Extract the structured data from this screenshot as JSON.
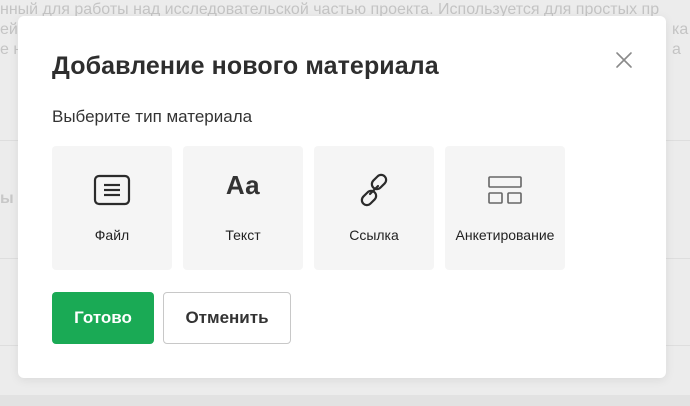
{
  "background": {
    "text_line": "нный для работы над исследовательской частью проекта. Используется для простых пр",
    "frag_right": "ка а",
    "frag_left": "ей",
    "frag_left2": "е н",
    "side_label": "ы"
  },
  "modal": {
    "title": "Добавление нового материала",
    "subtitle": "Выберите тип материала",
    "types": [
      {
        "label": "Файл",
        "icon": "file-icon"
      },
      {
        "label": "Текст",
        "icon": "text-icon",
        "glyph": "Aa"
      },
      {
        "label": "Ссылка",
        "icon": "link-icon"
      },
      {
        "label": "Анкетирование",
        "icon": "survey-icon"
      }
    ],
    "done_label": "Готово",
    "cancel_label": "Отменить",
    "close_icon": "close-icon"
  },
  "colors": {
    "accent": "#1aaa55",
    "title_text": "#2e2e2e",
    "card_bg": "#f5f5f5"
  }
}
